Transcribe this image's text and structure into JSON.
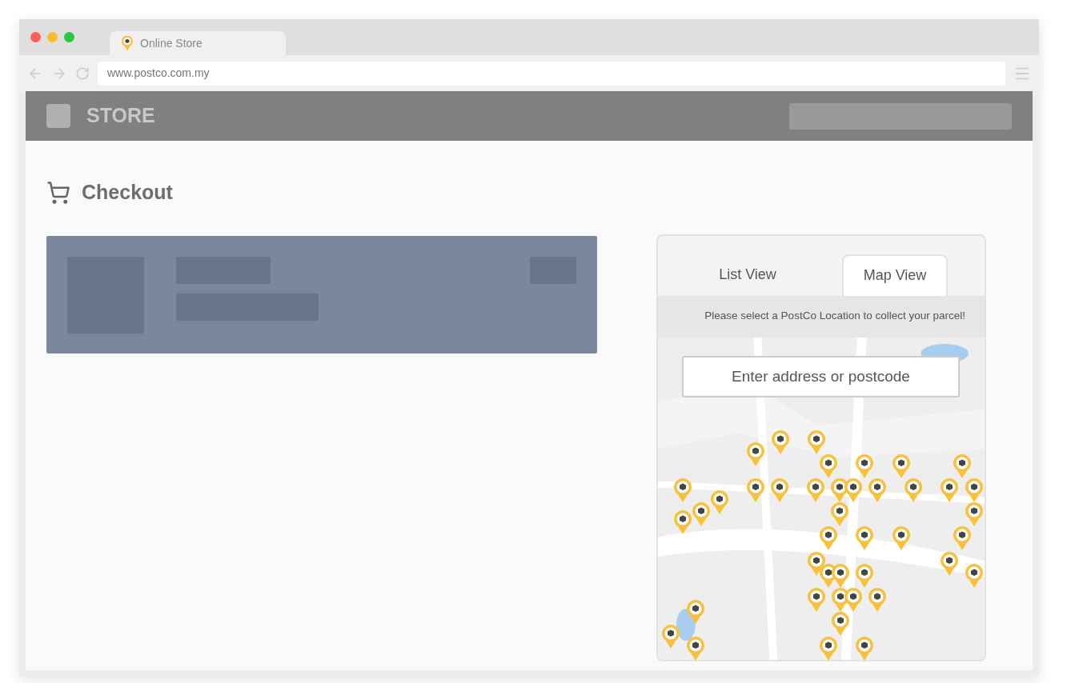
{
  "browser": {
    "tab_title": "Online Store",
    "url": "www.postco.com.my"
  },
  "header": {
    "brand": "STORE"
  },
  "page": {
    "title": "Checkout"
  },
  "locator": {
    "tabs": [
      {
        "label": "List View",
        "selected": false
      },
      {
        "label": "Map View",
        "selected": true
      }
    ],
    "message": "Please select a PostCo Location to collect your parcel!",
    "map": {
      "kind": "picture",
      "search": {
        "placeholder": "Enter address or postcode"
      }
    }
  }
}
